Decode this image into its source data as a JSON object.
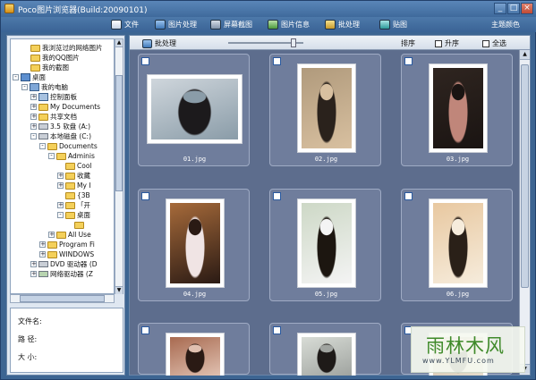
{
  "window": {
    "title": "Poco图片浏览器(Build:20090101)",
    "controls": {
      "minimize": "_",
      "maximize": "□",
      "close": "×"
    }
  },
  "toolbar": {
    "items": [
      {
        "label": "文件",
        "icon": "file-icon"
      },
      {
        "label": "图片处理",
        "icon": "image-edit-icon"
      },
      {
        "label": "屏幕截图",
        "icon": "screenshot-icon"
      },
      {
        "label": "图片信息",
        "icon": "info-icon"
      },
      {
        "label": "批处理",
        "icon": "batch-icon"
      },
      {
        "label": "贴图",
        "icon": "paste-icon"
      }
    ],
    "theme_label": "主题颜色"
  },
  "tree": {
    "items": [
      {
        "label": "我浏览过的网络图片",
        "expander": ""
      },
      {
        "label": "我的QQ图片",
        "expander": ""
      },
      {
        "label": "我的截图",
        "expander": ""
      },
      {
        "label": "桌面",
        "expander": "-"
      },
      {
        "label": "我的电脑",
        "expander": "-"
      },
      {
        "label": "控制面板",
        "expander": "+"
      },
      {
        "label": "My Documents",
        "expander": "+"
      },
      {
        "label": "共享文档",
        "expander": "+"
      },
      {
        "label": "3.5 软盘 (A:)",
        "expander": "+"
      },
      {
        "label": "本地磁盘 (C:)",
        "expander": "-"
      },
      {
        "label": "Documents",
        "expander": "-"
      },
      {
        "label": "Adminis",
        "expander": "-"
      },
      {
        "label": "Cool",
        "expander": ""
      },
      {
        "label": "收藏",
        "expander": "+"
      },
      {
        "label": "My I",
        "expander": "+"
      },
      {
        "label": "{3B",
        "expander": ""
      },
      {
        "label": "「开",
        "expander": "+"
      },
      {
        "label": "桌面",
        "expander": "-"
      },
      {
        "label": "",
        "expander": ""
      },
      {
        "label": "All Use",
        "expander": "+"
      },
      {
        "label": "Program Fi",
        "expander": "+"
      },
      {
        "label": "WINDOWS",
        "expander": "+"
      },
      {
        "label": "DVD 驱动器 (D",
        "expander": "+"
      },
      {
        "label": "网络驱动器 (Z",
        "expander": "+"
      }
    ],
    "scroll_up": "▲",
    "scroll_down": "▼"
  },
  "info": {
    "filename_label": "文件名:",
    "path_label": "路  径:",
    "size_label": "大  小:"
  },
  "viewer": {
    "batch_label": "批处理",
    "sort_label": "排序",
    "ascending_label": "升序",
    "select_all_label": "全选",
    "zoom_level": 0.85
  },
  "thumbnails": [
    {
      "name": "01.jpg",
      "orientation": "landscape",
      "colors": [
        "#cfd6dc",
        "#1c1a1c",
        "#8a9ca8"
      ]
    },
    {
      "name": "02.jpg",
      "orientation": "portrait",
      "colors": [
        "#b09a7c",
        "#2a221c",
        "#d8c0a0"
      ]
    },
    {
      "name": "03.jpg",
      "orientation": "portrait",
      "colors": [
        "#2f2520",
        "#c0867a",
        "#1a1412"
      ]
    },
    {
      "name": "04.jpg",
      "orientation": "portrait",
      "colors": [
        "#a66a3a",
        "#f0e4e4",
        "#2a1a14"
      ]
    },
    {
      "name": "05.jpg",
      "orientation": "portrait",
      "colors": [
        "#cdd8c6",
        "#1c1610",
        "#f4f4f4"
      ]
    },
    {
      "name": "06.jpg",
      "orientation": "portrait",
      "colors": [
        "#e8c8a0",
        "#2a2018",
        "#f6ecdc"
      ]
    },
    {
      "name": "",
      "orientation": "partial",
      "colors": [
        "#a86a50",
        "#2a1a14",
        "#e0c0b0"
      ]
    },
    {
      "name": "",
      "orientation": "partial",
      "colors": [
        "#d8dcd6",
        "#1e1a18",
        "#a0a4a0"
      ]
    },
    {
      "name": "",
      "orientation": "partial",
      "colors": [
        "#c8b098",
        "#241c18",
        "#e4dccc"
      ]
    }
  ],
  "watermark": {
    "brand": "雨林木风",
    "url": "www.YLMFU.com"
  },
  "colors": {
    "window_blue": "#3d6592",
    "viewer_bg": "#5d6d8d",
    "card_bg": "#6f7d9c"
  }
}
